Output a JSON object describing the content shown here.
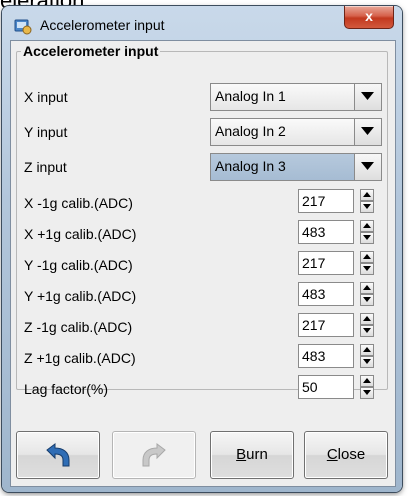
{
  "background_text": "eleration.",
  "window": {
    "title": "Accelerometer input",
    "close_label": "x"
  },
  "group": {
    "legend": "Accelerometer input"
  },
  "combos": [
    {
      "label": "X input",
      "value": "Analog In 1",
      "focused": false
    },
    {
      "label": "Y input",
      "value": "Analog In 2",
      "focused": false
    },
    {
      "label": "Z input",
      "value": "Analog In 3",
      "focused": true
    }
  ],
  "spinners": [
    {
      "label": "X -1g calib.(ADC)",
      "value": "217"
    },
    {
      "label": "X +1g calib.(ADC)",
      "value": "483"
    },
    {
      "label": "Y -1g calib.(ADC)",
      "value": "217"
    },
    {
      "label": "Y +1g calib.(ADC)",
      "value": "483"
    },
    {
      "label": "Z -1g calib.(ADC)",
      "value": "217"
    },
    {
      "label": "Z +1g calib.(ADC)",
      "value": "483"
    },
    {
      "label": "Lag factor(%)",
      "value": "50"
    }
  ],
  "buttons": {
    "undo_icon": "undo-arrow-icon",
    "redo_icon": "redo-arrow-icon",
    "burn_mnemonic": "B",
    "burn_rest": "urn",
    "close_mnemonic": "C",
    "close_rest": "lose"
  }
}
